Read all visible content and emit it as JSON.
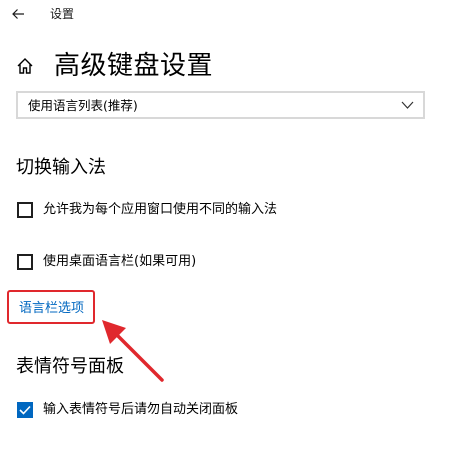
{
  "titlebar": {
    "title": "设置",
    "back_icon": "back-arrow-icon"
  },
  "header": {
    "home_icon": "home-icon",
    "title": "高级键盘设置"
  },
  "language_dropdown": {
    "selected": "使用语言列表(推荐)",
    "icon": "chevron-down-icon"
  },
  "switch_input": {
    "title": "切换输入法",
    "options": [
      {
        "label": "允许我为每个应用窗口使用不同的输入法",
        "checked": false
      },
      {
        "label": "使用桌面语言栏(如果可用)",
        "checked": false
      }
    ],
    "link": "语言栏选项"
  },
  "emoji_panel": {
    "title": "表情符号面板",
    "options": [
      {
        "label": "输入表情符号后请勿自动关闭面板",
        "checked": true
      }
    ]
  },
  "annotation": {
    "highlight_color": "#e0282d",
    "accent_color": "#0067c0"
  }
}
